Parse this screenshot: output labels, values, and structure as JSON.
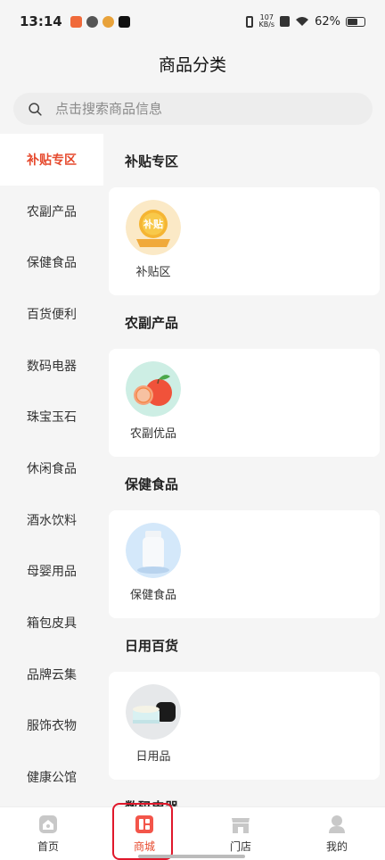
{
  "status_bar": {
    "time": "13:14",
    "net_speed_top": "107",
    "net_speed_bottom": "KB/s",
    "battery": "62%"
  },
  "header": {
    "title": "商品分类"
  },
  "search": {
    "placeholder": "点击搜索商品信息"
  },
  "sidebar": {
    "items": [
      {
        "label": "补贴专区",
        "active": true
      },
      {
        "label": "农副产品"
      },
      {
        "label": "保健食品"
      },
      {
        "label": "百货便利"
      },
      {
        "label": "数码电器"
      },
      {
        "label": "珠宝玉石"
      },
      {
        "label": "休闲食品"
      },
      {
        "label": "酒水饮料"
      },
      {
        "label": "母婴用品"
      },
      {
        "label": "箱包皮具"
      },
      {
        "label": "品牌云集"
      },
      {
        "label": "服饰衣物"
      },
      {
        "label": "健康公馆"
      }
    ]
  },
  "sections": [
    {
      "title": "补贴专区",
      "item": "补贴区",
      "badge": "补贴",
      "icon": "subsidy-badge-icon"
    },
    {
      "title": "农副产品",
      "item": "农副优品",
      "icon": "fruit-icon"
    },
    {
      "title": "保健食品",
      "item": "保健食品",
      "icon": "supplement-bottle-icon"
    },
    {
      "title": "日用百货",
      "item": "日用品",
      "icon": "cream-jar-icon"
    },
    {
      "title": "数码电器"
    }
  ],
  "tabbar": {
    "tabs": [
      {
        "label": "首页",
        "icon": "home-icon"
      },
      {
        "label": "商城",
        "icon": "mall-icon",
        "active": true
      },
      {
        "label": "门店",
        "icon": "store-icon"
      },
      {
        "label": "我的",
        "icon": "profile-icon"
      }
    ]
  },
  "colors": {
    "accent": "#e64a2e",
    "highlight_border": "#e0182b"
  }
}
